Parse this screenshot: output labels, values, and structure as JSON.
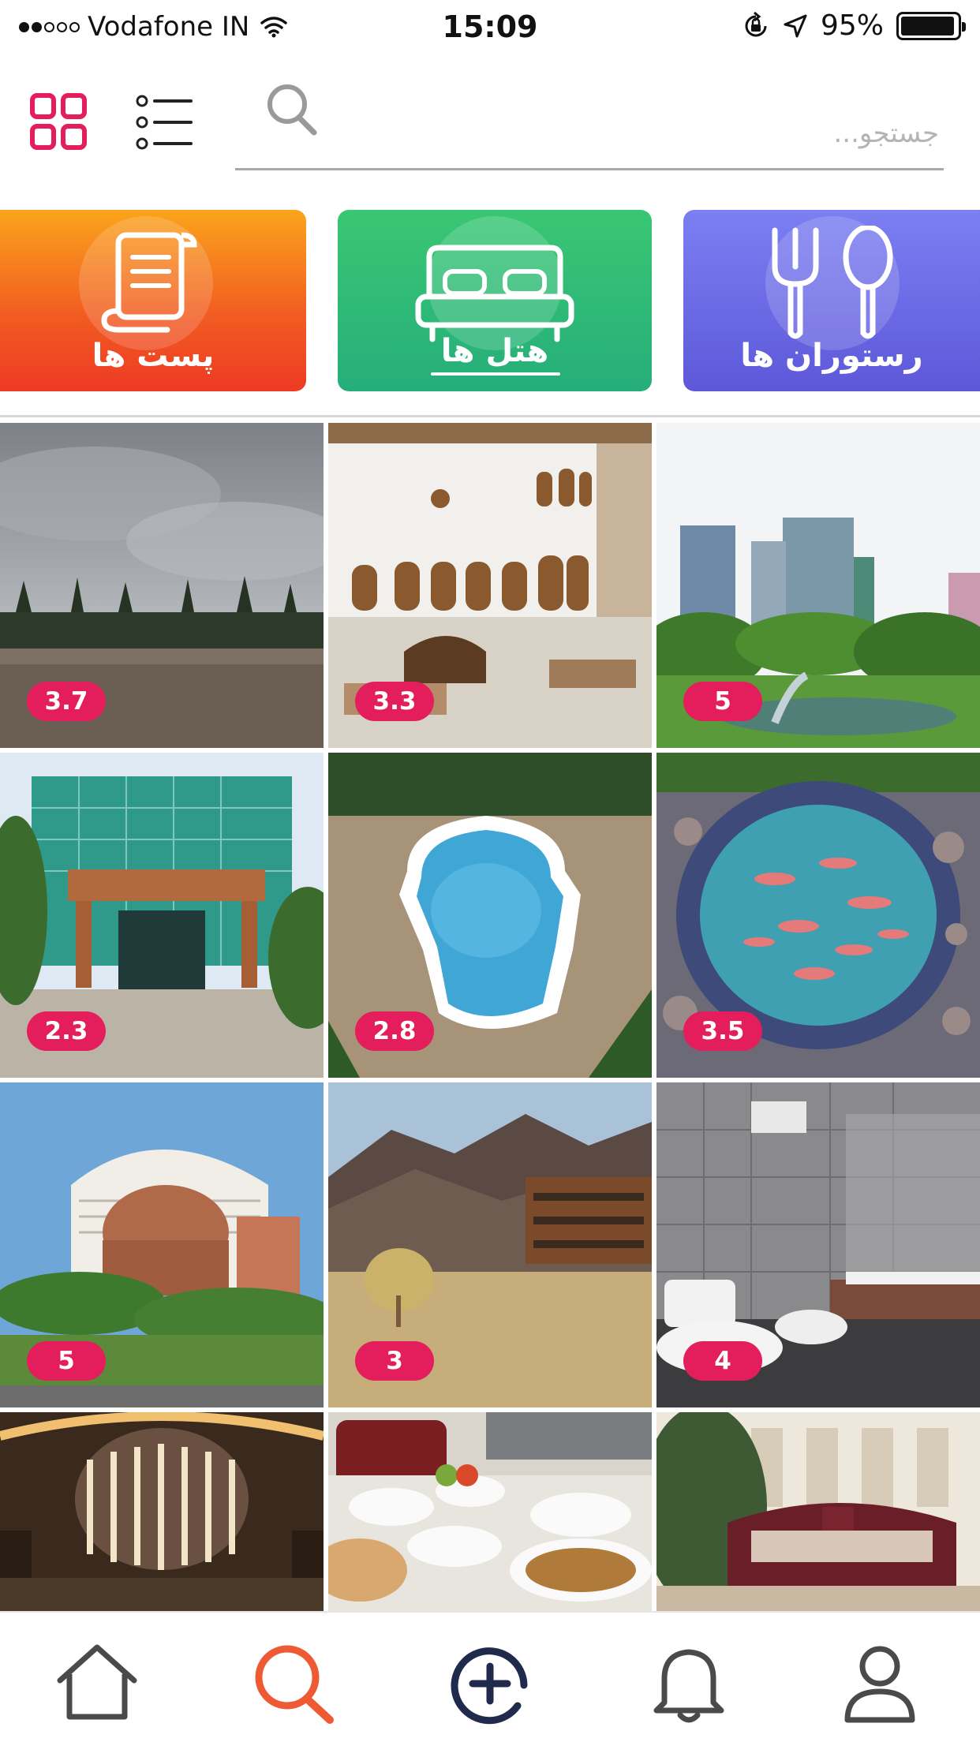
{
  "status_bar": {
    "carrier": "Vodafone IN",
    "time": "15:09",
    "battery": "95%",
    "battery_level": 0.95,
    "signal_bars": 2,
    "signal_total": 5
  },
  "header": {
    "grid_view_icon": "grid-icon",
    "list_view_icon": "list-icon",
    "search": {
      "placeholder": "جستجو...",
      "value": "",
      "icon": "search-icon"
    }
  },
  "categories": [
    {
      "label": "پست ها",
      "icon": "scroll-icon",
      "selected": false
    },
    {
      "label": "هتل ها",
      "icon": "bed-icon",
      "selected": true
    },
    {
      "label": "رستوران ها",
      "icon": "fork-spoon-icon",
      "selected": false
    }
  ],
  "tiles": [
    {
      "rating": "3.7",
      "scene": "beach-palms"
    },
    {
      "rating": "3.3",
      "scene": "courtyard"
    },
    {
      "rating": "5",
      "scene": "city-park"
    },
    {
      "rating": "2.3",
      "scene": "glass-hotel"
    },
    {
      "rating": "2.8",
      "scene": "pool"
    },
    {
      "rating": "3.5",
      "scene": "fish-pond"
    },
    {
      "rating": "5",
      "scene": "tower-hotel"
    },
    {
      "rating": "3",
      "scene": "mountain-lodge"
    },
    {
      "rating": "4",
      "scene": "bathroom"
    },
    {
      "rating": "",
      "scene": "chandelier"
    },
    {
      "rating": "",
      "scene": "dining-table"
    },
    {
      "rating": "",
      "scene": "hotel-facade"
    }
  ],
  "bottom_nav": [
    {
      "icon": "home-icon",
      "active": false
    },
    {
      "icon": "search-icon",
      "active": true
    },
    {
      "icon": "add-circle-icon",
      "active": false
    },
    {
      "icon": "bell-icon",
      "active": false
    },
    {
      "icon": "user-icon",
      "active": false
    }
  ],
  "colors": {
    "accent": "#e41d5c",
    "search_active": "#ee5a33",
    "add_button": "#1f2a4d",
    "nav_inactive": "#4a4a4a"
  }
}
